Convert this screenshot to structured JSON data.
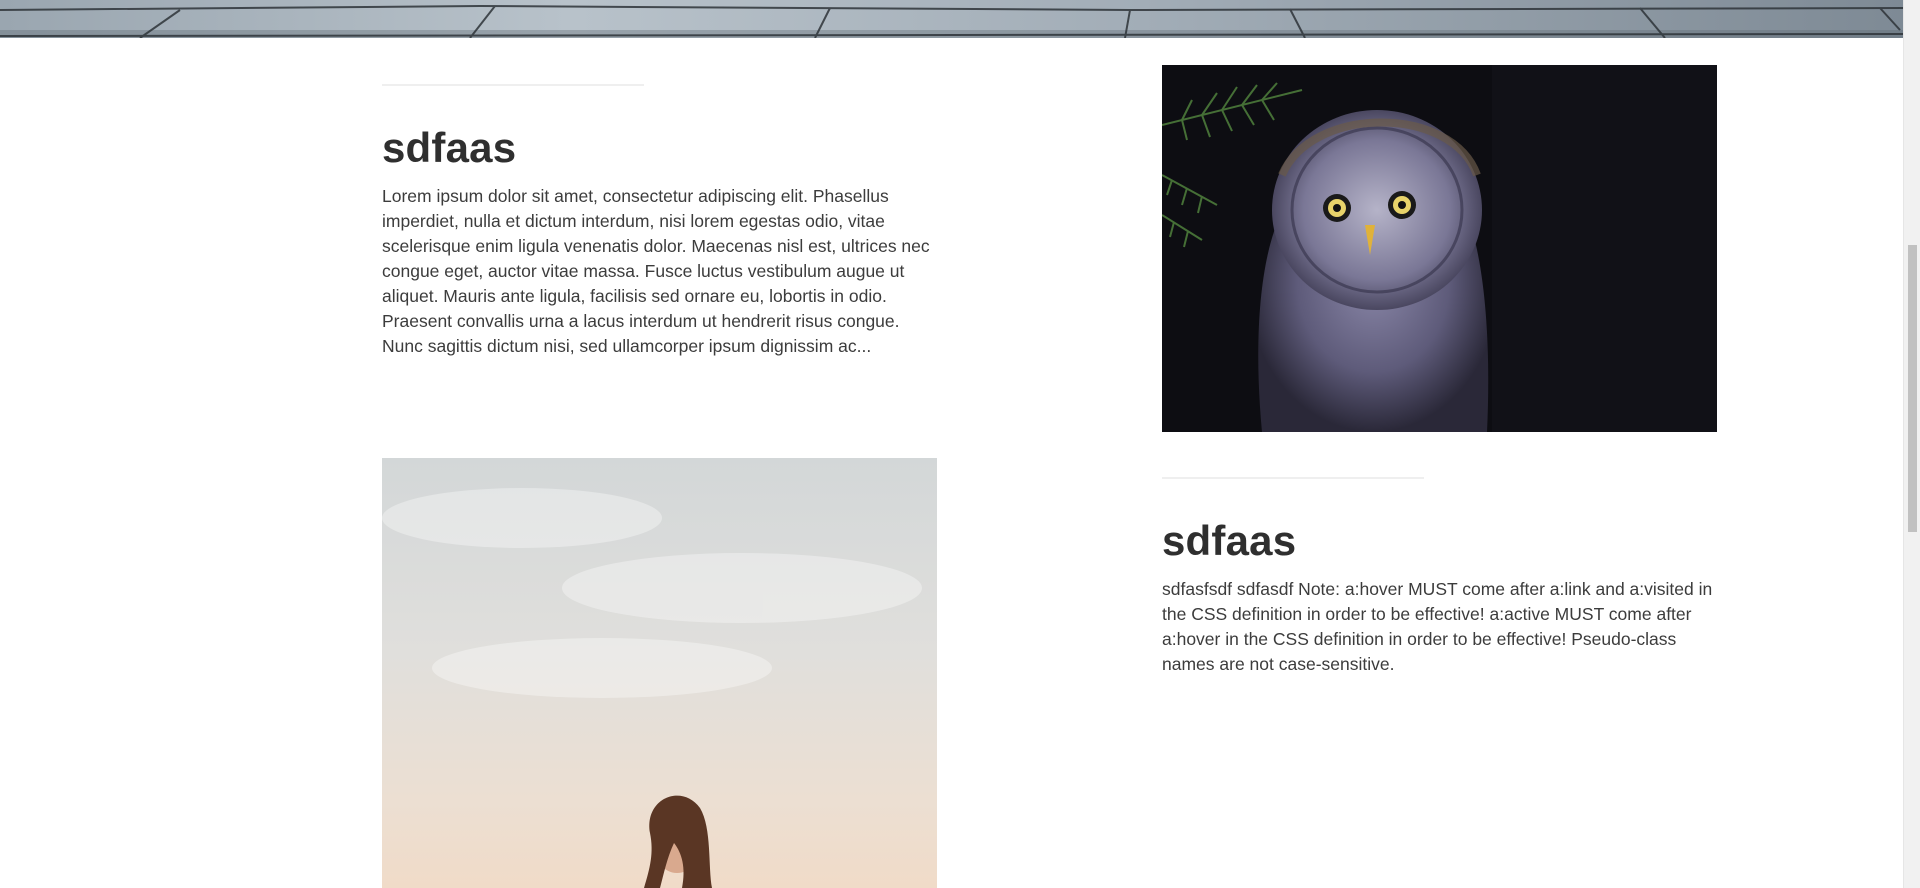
{
  "entries": [
    {
      "title": "sdfaas",
      "body": "Lorem ipsum dolor sit amet, consectetur adipiscing elit. Phasellus imperdiet, nulla et dictum interdum, nisi lorem egestas odio, vitae scelerisque enim ligula venenatis dolor. Maecenas nisl est, ultrices nec congue eget, auctor vitae massa. Fusce luctus vestibulum augue ut aliquet. Mauris ante ligula, facilisis sed ornare eu, lobortis in odio. Praesent convallis urna a lacus interdum ut hendrerit risus congue. Nunc sagittis dictum nisi, sed ullamcorper ipsum dignissim ac..."
    },
    {
      "title": "sdfaas",
      "body": "sdfasfsdf sdfasdf Note: a:hover MUST come after a:link and a:visited in the CSS definition in order to be effective! a:active MUST come after a:hover in the CSS definition in order to be effective! Pseudo-class names are not case-sensitive."
    }
  ],
  "images": {
    "hero": "pavement-photo",
    "owl": "owl-photo",
    "woman": "woman-photo"
  },
  "colors": {
    "heading": "#2f2f2f",
    "body_text": "#3c3c3c",
    "divider": "#efefef",
    "background": "#ffffff"
  }
}
